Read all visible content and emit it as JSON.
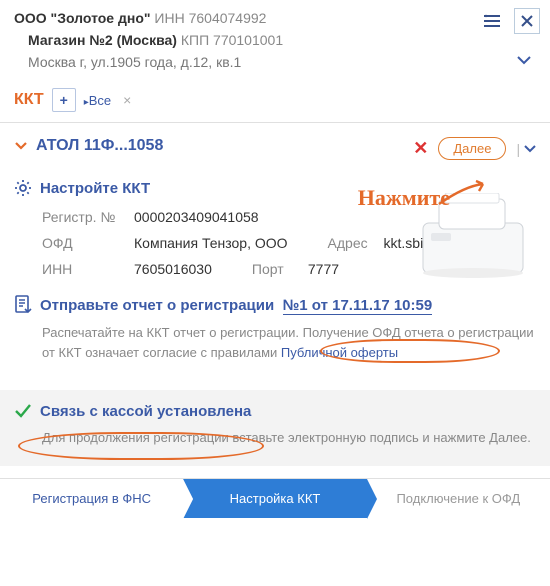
{
  "header": {
    "org_name": "ООО \"Золотое дно\"",
    "inn_label": "ИНН",
    "inn_value": "7604074992",
    "shop_name": "Магазин №2 (Москва)",
    "kpp_label": "КПП",
    "kpp_value": "770101001",
    "address": "Москва г, ул.1905 года, д.12, кв.1"
  },
  "kkt_row": {
    "label": "ККТ",
    "add": "+",
    "all_marker": "▸",
    "all_label": "Все",
    "close": "×"
  },
  "device": {
    "expand": "⌄",
    "title": "АТОЛ 11Ф...1058",
    "close_x": "✕",
    "next": "Далее",
    "vsep_chevron": "⌄",
    "vsep_bar": "|"
  },
  "configure": {
    "title": "Настройте ККТ",
    "reg_label": "Регистр. №",
    "reg_value": "0000203409041058",
    "ofd_label": "ОФД",
    "ofd_value": "Компания Тензор, ООО",
    "addr_label": "Адрес",
    "addr_value": "kkt.sbis.ru",
    "inn_label": "ИНН",
    "inn_value": "7605016030",
    "port_label": "Порт",
    "port_value": "7777"
  },
  "report": {
    "title_prefix": "Отправьте отчет о регистрации",
    "link": "№1 от 17.11.17 10:59",
    "help_1": "Распечатайте на ККТ отчет о регистрации. Получение ОФД отчета о регистрации от ККТ означает согласие с правилами ",
    "offer_link": "Публичной оферты"
  },
  "status": {
    "title": "Связь с кассой установлена",
    "help": "Для продолжения регистрации вставьте электронную подпись и нажмите Далее."
  },
  "tabs": {
    "t1": "Регистрация в ФНС",
    "t2": "Настройка ККТ",
    "t3": "Подключение к ОФД"
  },
  "annotation": {
    "press": "Нажмите"
  }
}
